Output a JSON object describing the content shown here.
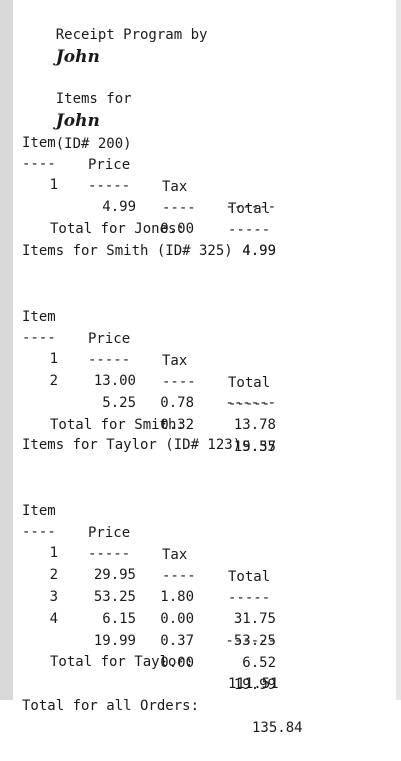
{
  "program_title": "Receipt Program by",
  "program_author": "John",
  "columns": {
    "item": "Item",
    "price": "Price",
    "tax": "Tax",
    "total": "Total"
  },
  "underline": {
    "item": "----",
    "price": "-----",
    "tax": "----",
    "total": "-----"
  },
  "total_rule": "------",
  "orders": [
    {
      "heading_prefix": "Items for",
      "name_handwritten": "John",
      "heading_suffix": "(ID# 200)",
      "rows": [
        {
          "item": "1",
          "price": "4.99",
          "tax": "0.00",
          "total": "4.99"
        }
      ],
      "total_label": "Total for Jones:",
      "total_value": "4.99"
    },
    {
      "heading": "Items for Smith (ID# 325)",
      "rows": [
        {
          "item": "1",
          "price": "13.00",
          "tax": "0.78",
          "total": "13.78"
        },
        {
          "item": "2",
          "price": "5.25",
          "tax": "0.32",
          "total": "5.57"
        }
      ],
      "total_label": "Total for Smith:",
      "total_value": "19.35"
    },
    {
      "heading": "Items for Taylor (ID# 123)",
      "rows": [
        {
          "item": "1",
          "price": "29.95",
          "tax": "1.80",
          "total": "31.75"
        },
        {
          "item": "2",
          "price": "53.25",
          "tax": "0.00",
          "total": "53.25"
        },
        {
          "item": "3",
          "price": "6.15",
          "tax": "0.37",
          "total": "6.52"
        },
        {
          "item": "4",
          "price": "19.99",
          "tax": "0.00",
          "total": "19.99"
        }
      ],
      "total_label": "Total for Taylor:",
      "total_value": "111.51"
    }
  ],
  "grand_total_label": "Total for all Orders:",
  "grand_total_value": "135.84"
}
